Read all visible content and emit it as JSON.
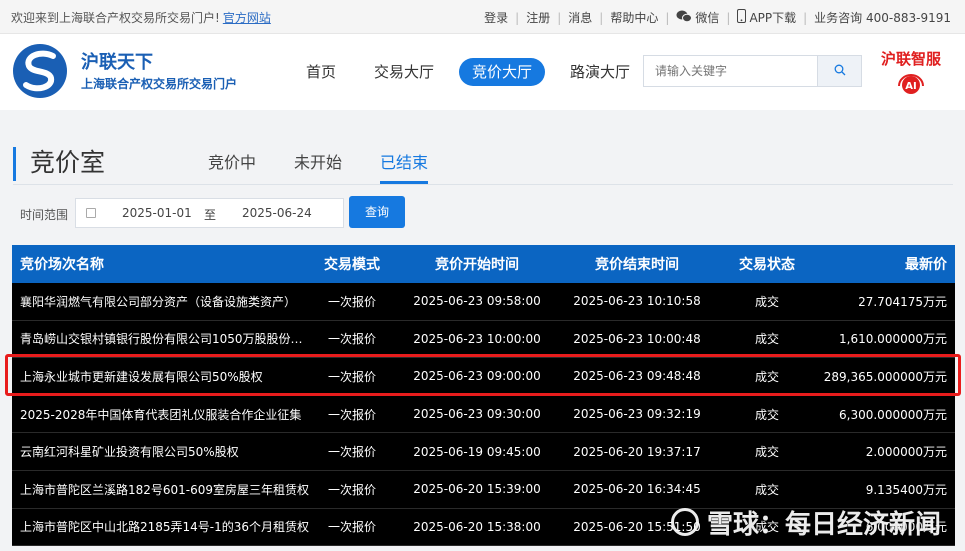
{
  "topbar": {
    "welcome": "欢迎来到上海联合产权交易所交易门户!",
    "official_link": "官方网站",
    "links": [
      "登录",
      "注册",
      "消息",
      "帮助中心",
      "微信",
      "APP下载"
    ],
    "hotline": "业务咨询 400-883-9191"
  },
  "header": {
    "brand_title": "沪联天下",
    "brand_sub": "上海联合产权交易所交易门户",
    "nav": [
      "首页",
      "交易大厅",
      "竞价大厅",
      "路演大厅"
    ],
    "nav_active": "竞价大厅",
    "search_placeholder": "请输入关键字",
    "ai_label": "沪联智服",
    "ai_badge": "AI"
  },
  "page": {
    "title": "竞价室",
    "tabs": [
      "竞价中",
      "未开始",
      "已结束"
    ],
    "active_tab": "已结束"
  },
  "filter": {
    "label": "时间范围",
    "start": "2025-01-01",
    "to": "至",
    "end": "2025-06-24",
    "query": "查询"
  },
  "table": {
    "headers": [
      "竞价场次名称",
      "交易模式",
      "竞价开始时间",
      "竞价结束时间",
      "交易状态",
      "最新价"
    ],
    "rows": [
      [
        "襄阳华润燃气有限公司部分资产（设备设施类资产）",
        "一次报价",
        "2025-06-23 09:58:00",
        "2025-06-23 10:10:58",
        "成交",
        "27.704175万元"
      ],
      [
        "青岛崂山交银村镇银行股份有限公司1050万股股份（...",
        "一次报价",
        "2025-06-23 10:00:00",
        "2025-06-23 10:00:48",
        "成交",
        "1,610.000000万元"
      ],
      [
        "上海永业城市更新建设发展有限公司50%股权",
        "一次报价",
        "2025-06-23 09:00:00",
        "2025-06-23 09:48:48",
        "成交",
        "289,365.000000万元"
      ],
      [
        "2025-2028年中国体育代表团礼仪服装合作企业征集",
        "一次报价",
        "2025-06-23 09:30:00",
        "2025-06-23 09:32:19",
        "成交",
        "6,300.000000万元"
      ],
      [
        "云南红河科星矿业投资有限公司50%股权",
        "一次报价",
        "2025-06-19 09:45:00",
        "2025-06-20 19:37:17",
        "成交",
        "2.000000万元"
      ],
      [
        "上海市普陀区兰溪路182号601-609室房屋三年租赁权",
        "一次报价",
        "2025-06-20 15:39:00",
        "2025-06-20 16:34:45",
        "成交",
        "9.135400万元"
      ],
      [
        "上海市普陀区中山北路2185弄14号-1的36个月租赁权",
        "一次报价",
        "2025-06-20 15:38:00",
        "2025-06-20 15:51:50",
        "成交",
        "6.000000万元"
      ]
    ],
    "highlight_row": 2
  },
  "watermark": {
    "text": "雪球：每日经济新闻"
  }
}
